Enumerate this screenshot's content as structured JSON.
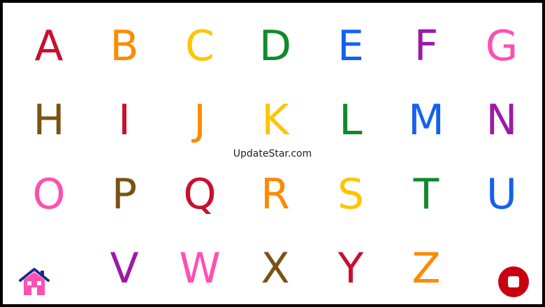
{
  "watermark": "UpdateStar.com",
  "letters": [
    {
      "char": "A",
      "color": "#c8102e"
    },
    {
      "char": "B",
      "color": "#ff8a00"
    },
    {
      "char": "C",
      "color": "#ffc400"
    },
    {
      "char": "D",
      "color": "#0f8a2c"
    },
    {
      "char": "E",
      "color": "#1460f0"
    },
    {
      "char": "F",
      "color": "#9b1aa8"
    },
    {
      "char": "G",
      "color": "#ff4fb1"
    },
    {
      "char": "H",
      "color": "#7a5212"
    },
    {
      "char": "I",
      "color": "#c8102e"
    },
    {
      "char": "J",
      "color": "#ff8a00"
    },
    {
      "char": "K",
      "color": "#ffc400"
    },
    {
      "char": "L",
      "color": "#0f8a2c"
    },
    {
      "char": "M",
      "color": "#1460f0"
    },
    {
      "char": "N",
      "color": "#9b1aa8"
    },
    {
      "char": "O",
      "color": "#ff4fb1"
    },
    {
      "char": "P",
      "color": "#7a5212"
    },
    {
      "char": "Q",
      "color": "#c8102e"
    },
    {
      "char": "R",
      "color": "#ff8a00"
    },
    {
      "char": "S",
      "color": "#ffc400"
    },
    {
      "char": "T",
      "color": "#0f8a2c"
    },
    {
      "char": "U",
      "color": "#1460f0"
    },
    {
      "char": "V",
      "color": "#9b1aa8"
    },
    {
      "char": "W",
      "color": "#ff4fb1"
    },
    {
      "char": "X",
      "color": "#7a5212"
    },
    {
      "char": "Y",
      "color": "#c8102e"
    },
    {
      "char": "Z",
      "color": "#ff8a00"
    }
  ],
  "home_button": {
    "icon": "home-icon",
    "roof_color": "#1a2a8c",
    "house_color": "#ff4fb1"
  },
  "stop_button": {
    "icon": "stop-icon",
    "color": "#c8000f"
  }
}
